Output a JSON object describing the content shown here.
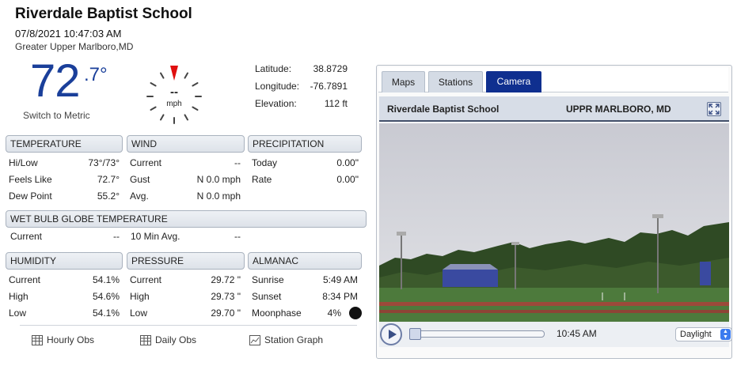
{
  "header": {
    "title": "Riverdale Baptist School",
    "datetime": "07/8/2021 10:47:03 AM",
    "location": "Greater Upper Marlboro,MD"
  },
  "current": {
    "temp_whole": "72",
    "temp_decimal": ".7°",
    "switch_label": "Switch to Metric",
    "wind_value": "--",
    "wind_unit": "mph"
  },
  "geo": {
    "latitude_label": "Latitude:",
    "latitude": "38.8729",
    "longitude_label": "Longitude:",
    "longitude": "-76.7891",
    "elevation_label": "Elevation:",
    "elevation": "112 ft"
  },
  "temperature": {
    "heading": "TEMPERATURE",
    "rows": [
      {
        "label": "Hi/Low",
        "value": "73°/73°"
      },
      {
        "label": "Feels Like",
        "value": "72.7°"
      },
      {
        "label": "Dew Point",
        "value": "55.2°"
      }
    ]
  },
  "wind": {
    "heading": "WIND",
    "rows": [
      {
        "label": "Current",
        "value": "--"
      },
      {
        "label": "Gust",
        "value": "N 0.0 mph"
      },
      {
        "label": "Avg.",
        "value": "N 0.0 mph"
      }
    ]
  },
  "precipitation": {
    "heading": "PRECIPITATION",
    "rows": [
      {
        "label": "Today",
        "value": "0.00\""
      },
      {
        "label": "Rate",
        "value": "0.00\""
      }
    ]
  },
  "wbgt": {
    "heading": "WET BULB GLOBE TEMPERATURE",
    "current_label": "Current",
    "current_value": "--",
    "avg_label": "10 Min Avg.",
    "avg_value": "--"
  },
  "humidity": {
    "heading": "HUMIDITY",
    "rows": [
      {
        "label": "Current",
        "value": "54.1%"
      },
      {
        "label": "High",
        "value": "54.6%"
      },
      {
        "label": "Low",
        "value": "54.1%"
      }
    ]
  },
  "pressure": {
    "heading": "PRESSURE",
    "rows": [
      {
        "label": "Current",
        "value": "29.72 \""
      },
      {
        "label": "High",
        "value": "29.73 \""
      },
      {
        "label": "Low",
        "value": "29.70 \""
      }
    ]
  },
  "almanac": {
    "heading": "ALMANAC",
    "rows": [
      {
        "label": "Sunrise",
        "value": "5:49 AM"
      },
      {
        "label": "Sunset",
        "value": "8:34 PM"
      },
      {
        "label": "Moonphase",
        "value": "4%"
      }
    ]
  },
  "links": {
    "hourly": "Hourly Obs",
    "daily": "Daily Obs",
    "graph": "Station Graph"
  },
  "camera": {
    "tabs": [
      "Maps",
      "Stations",
      "Camera"
    ],
    "active_tab": "Camera",
    "title": "Riverdale Baptist School",
    "location": "UPPR MARLBORO, MD",
    "time": "10:45 AM",
    "mode": "Daylight",
    "slider_progress": 0
  },
  "colors": {
    "accent": "#1a3f9a",
    "tab_active": "#0f2f8f"
  }
}
